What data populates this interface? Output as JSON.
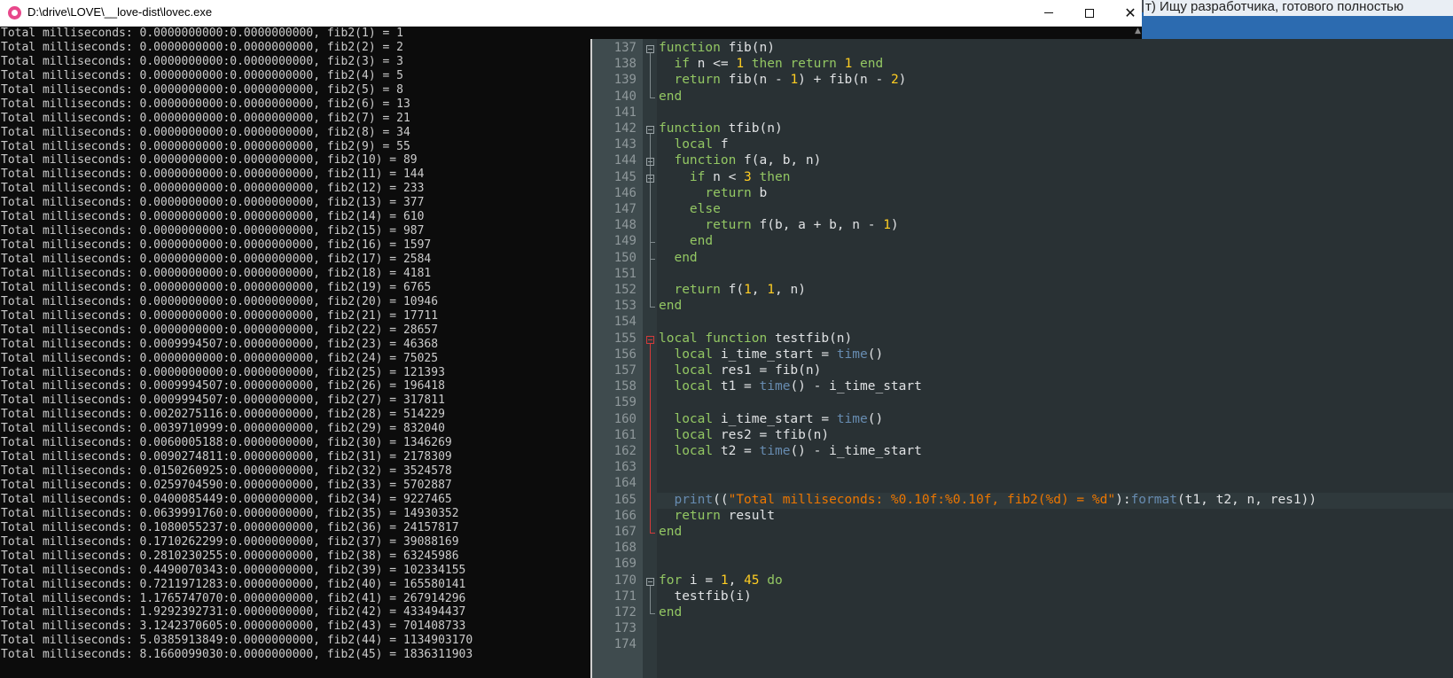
{
  "background_window": {
    "text": "т) Ищу разработчика, готового полностью"
  },
  "console": {
    "title": "D:\\drive\\LOVE\\__love-dist\\lovec.exe",
    "buttons": {
      "minimize": "minimize",
      "maximize": "maximize",
      "close": "close"
    },
    "lines": [
      "Total milliseconds: 0.0000000000:0.0000000000, fib2(1) = 1",
      "Total milliseconds: 0.0000000000:0.0000000000, fib2(2) = 2",
      "Total milliseconds: 0.0000000000:0.0000000000, fib2(3) = 3",
      "Total milliseconds: 0.0000000000:0.0000000000, fib2(4) = 5",
      "Total milliseconds: 0.0000000000:0.0000000000, fib2(5) = 8",
      "Total milliseconds: 0.0000000000:0.0000000000, fib2(6) = 13",
      "Total milliseconds: 0.0000000000:0.0000000000, fib2(7) = 21",
      "Total milliseconds: 0.0000000000:0.0000000000, fib2(8) = 34",
      "Total milliseconds: 0.0000000000:0.0000000000, fib2(9) = 55",
      "Total milliseconds: 0.0000000000:0.0000000000, fib2(10) = 89",
      "Total milliseconds: 0.0000000000:0.0000000000, fib2(11) = 144",
      "Total milliseconds: 0.0000000000:0.0000000000, fib2(12) = 233",
      "Total milliseconds: 0.0000000000:0.0000000000, fib2(13) = 377",
      "Total milliseconds: 0.0000000000:0.0000000000, fib2(14) = 610",
      "Total milliseconds: 0.0000000000:0.0000000000, fib2(15) = 987",
      "Total milliseconds: 0.0000000000:0.0000000000, fib2(16) = 1597",
      "Total milliseconds: 0.0000000000:0.0000000000, fib2(17) = 2584",
      "Total milliseconds: 0.0000000000:0.0000000000, fib2(18) = 4181",
      "Total milliseconds: 0.0000000000:0.0000000000, fib2(19) = 6765",
      "Total milliseconds: 0.0000000000:0.0000000000, fib2(20) = 10946",
      "Total milliseconds: 0.0000000000:0.0000000000, fib2(21) = 17711",
      "Total milliseconds: 0.0000000000:0.0000000000, fib2(22) = 28657",
      "Total milliseconds: 0.0009994507:0.0000000000, fib2(23) = 46368",
      "Total milliseconds: 0.0000000000:0.0000000000, fib2(24) = 75025",
      "Total milliseconds: 0.0000000000:0.0000000000, fib2(25) = 121393",
      "Total milliseconds: 0.0009994507:0.0000000000, fib2(26) = 196418",
      "Total milliseconds: 0.0009994507:0.0000000000, fib2(27) = 317811",
      "Total milliseconds: 0.0020275116:0.0000000000, fib2(28) = 514229",
      "Total milliseconds: 0.0039710999:0.0000000000, fib2(29) = 832040",
      "Total milliseconds: 0.0060005188:0.0000000000, fib2(30) = 1346269",
      "Total milliseconds: 0.0090274811:0.0000000000, fib2(31) = 2178309",
      "Total milliseconds: 0.0150260925:0.0000000000, fib2(32) = 3524578",
      "Total milliseconds: 0.0259704590:0.0000000000, fib2(33) = 5702887",
      "Total milliseconds: 0.0400085449:0.0000000000, fib2(34) = 9227465",
      "Total milliseconds: 0.0639991760:0.0000000000, fib2(35) = 14930352",
      "Total milliseconds: 0.1080055237:0.0000000000, fib2(36) = 24157817",
      "Total milliseconds: 0.1710262299:0.0000000000, fib2(37) = 39088169",
      "Total milliseconds: 0.2810230255:0.0000000000, fib2(38) = 63245986",
      "Total milliseconds: 0.4490070343:0.0000000000, fib2(39) = 102334155",
      "Total milliseconds: 0.7211971283:0.0000000000, fib2(40) = 165580141",
      "Total milliseconds: 1.1765747070:0.0000000000, fib2(41) = 267914296",
      "Total milliseconds: 1.9292392731:0.0000000000, fib2(42) = 433494437",
      "Total milliseconds: 3.1242370605:0.0000000000, fib2(43) = 701408733",
      "Total milliseconds: 5.0385913849:0.0000000000, fib2(44) = 1134903170",
      "Total milliseconds: 8.1660099030:0.0000000000, fib2(45) = 1836311903"
    ]
  },
  "editor": {
    "line_numbers": [
      "137",
      "138",
      "139",
      "140",
      "141",
      "142",
      "143",
      "144",
      "145",
      "146",
      "147",
      "148",
      "149",
      "150",
      "151",
      "152",
      "153",
      "154",
      "155",
      "156",
      "157",
      "158",
      "159",
      "160",
      "161",
      "162",
      "163",
      "164",
      "165",
      "166",
      "167",
      "168",
      "169",
      "170",
      "171",
      "172",
      "173",
      "174"
    ],
    "code": [
      "function fib(n)",
      "  if n <= 1 then return 1 end",
      "  return fib(n - 1) + fib(n - 2)",
      "end",
      "",
      "function tfib(n)",
      "  local f",
      "  function f(a, b, n)",
      "    if n < 3 then",
      "      return b",
      "    else",
      "      return f(b, a + b, n - 1)",
      "    end",
      "  end",
      "",
      "  return f(1, 1, n)",
      "end",
      "",
      "local function testfib(n)",
      "  local i_time_start = time()",
      "  local res1 = fib(n)",
      "  local t1 = time() - i_time_start",
      "",
      "  local i_time_start = time()",
      "  local res2 = tfib(n)",
      "  local t2 = time() - i_time_start",
      "",
      "",
      "  print((\"Total milliseconds: %0.10f:%0.10f, fib2(%d) = %d\"):format(t1, t2, n, res1))",
      "  return result",
      "end",
      "",
      "",
      "for i = 1, 45 do",
      "  testfib(i)",
      "end",
      "",
      ""
    ],
    "syntax_colors": {
      "keyword": "#93c763",
      "number": "#ffcd22",
      "string": "#ec7600",
      "builtin": "#678cb1",
      "text": "#e0e2e4",
      "background": "#293134"
    }
  }
}
